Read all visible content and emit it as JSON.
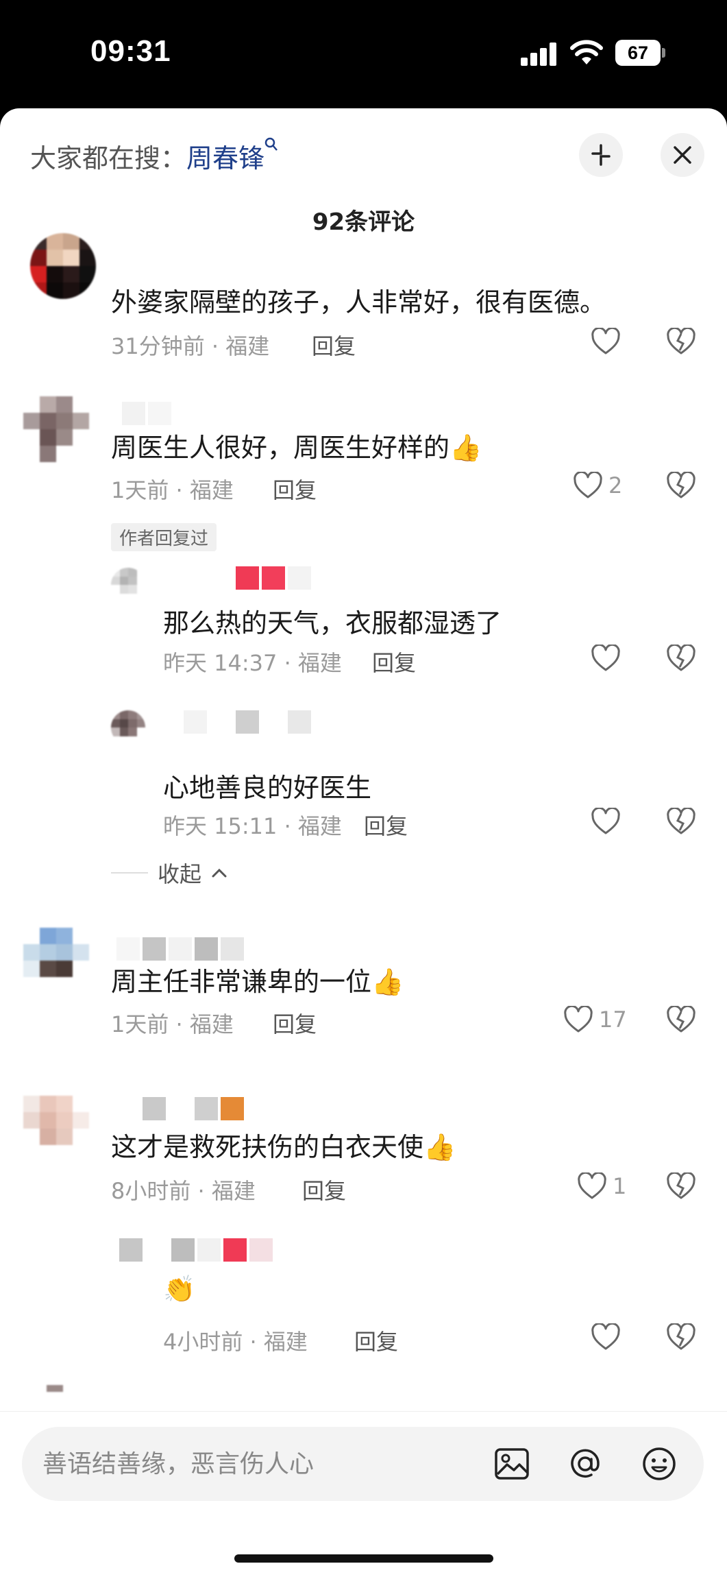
{
  "status_bar": {
    "time": "09:31",
    "battery": "67"
  },
  "header": {
    "search_prefix": "大家都在搜：",
    "search_term": "周春锋",
    "comment_count": "92条评论"
  },
  "comments": [
    {
      "text": "外婆家隔壁的孩子，人非常好，很有医德。",
      "meta": "31分钟前 · 福建",
      "reply": "回复",
      "likes": ""
    },
    {
      "text": "周医生人很好，周医生好样的👍",
      "meta": "1天前 · 福建",
      "reply": "回复",
      "likes": "2",
      "badge": "作者回复过"
    },
    {
      "text": "周主任非常谦卑的一位👍",
      "meta": "1天前 · 福建",
      "reply": "回复",
      "likes": "17"
    },
    {
      "text": "这才是救死扶伤的白衣天使👍",
      "meta": "8小时前 · 福建",
      "reply": "回复",
      "likes": "1"
    }
  ],
  "replies": [
    {
      "text": "那么热的天气，衣服都湿透了",
      "meta": "昨天 14:37 · 福建",
      "reply": "回复"
    },
    {
      "text": "心地善良的好医生",
      "meta": "昨天 15:11 · 福建",
      "reply": "回复"
    },
    {
      "text": "👏",
      "meta": "4小时前 · 福建",
      "reply": "回复"
    }
  ],
  "collapse_label": "收起",
  "input": {
    "placeholder": "善语结善缘，恶言伤人心"
  },
  "colors": {
    "search_term": "#1f3f8a",
    "badge_bg": "#f0f0f0",
    "meta": "#9a9a9a"
  },
  "icons": [
    "signal-icon",
    "wifi-icon",
    "battery-icon",
    "search-icon",
    "collapse-icon",
    "close-icon",
    "heart-icon",
    "broken-heart-icon",
    "chevron-up-icon",
    "image-icon",
    "at-icon",
    "emoji-icon"
  ]
}
